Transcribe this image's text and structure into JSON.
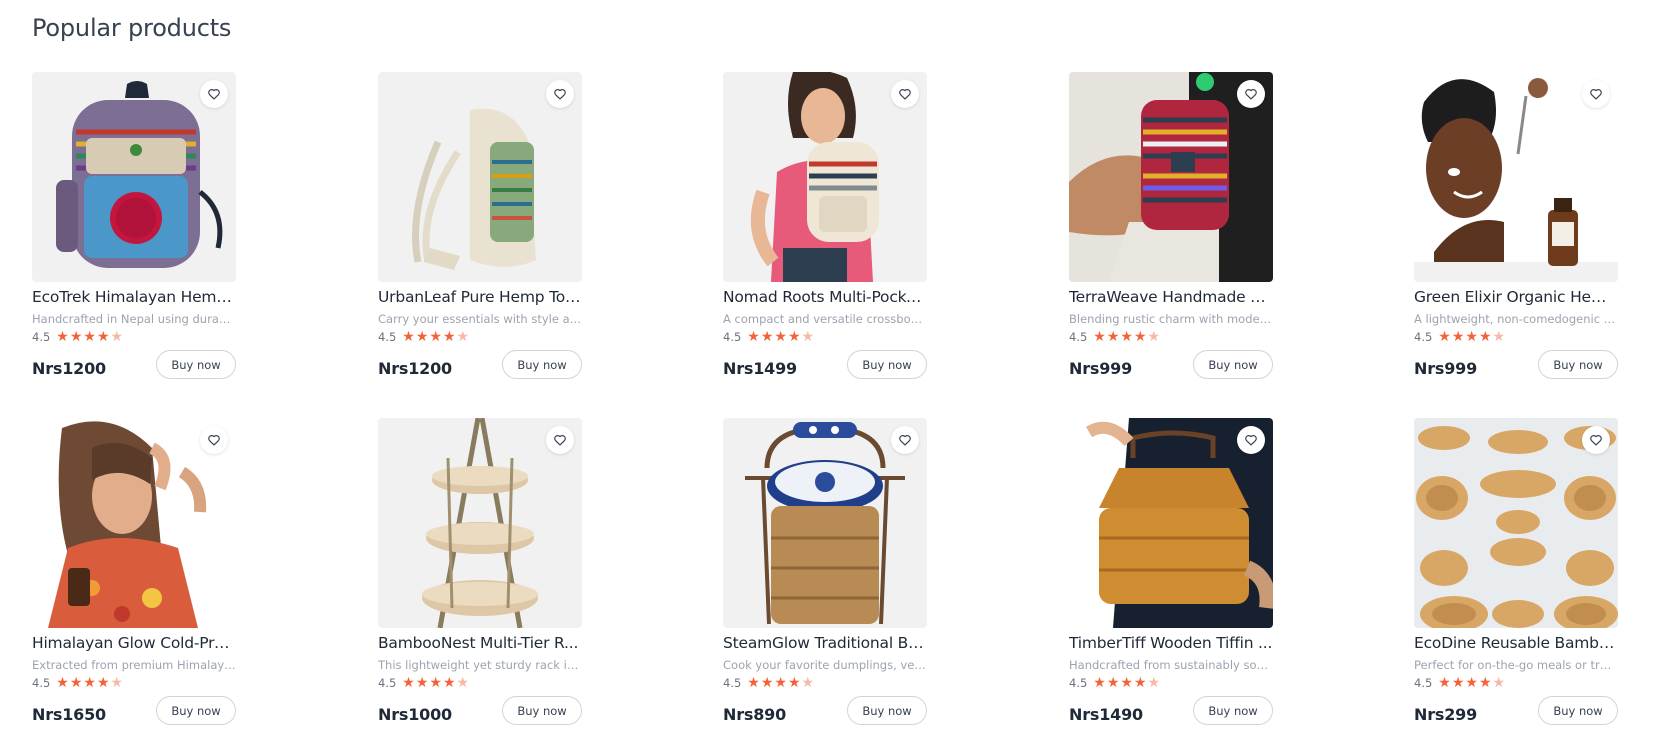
{
  "section": {
    "title": "Popular products"
  },
  "colors": {
    "star_on": "#f4623a",
    "star_off": "#f7b9a7",
    "thumb_bg": "#f1f1f2"
  },
  "products": [
    {
      "name": "EcoTrek Himalayan Hemp ...",
      "desc": "Handcrafted in Nepal using durable ...",
      "rating": "4.5",
      "stars_filled": 4,
      "price": "Nrs1200",
      "button": "Buy now",
      "image_icon": "hemp-backpack-icon"
    },
    {
      "name": "UrbanLeaf Pure Hemp Tot...",
      "desc": "Carry your essentials with style and ...",
      "rating": "4.5",
      "stars_filled": 4,
      "price": "Nrs1200",
      "button": "Buy now",
      "image_icon": "hemp-tote-backpack-icon"
    },
    {
      "name": "Nomad Roots Multi-Pocke...",
      "desc": "A compact and versatile crossbody ...",
      "rating": "4.5",
      "stars_filled": 4,
      "price": "Nrs1499",
      "button": "Buy now",
      "image_icon": "woman-with-backpack-icon"
    },
    {
      "name": "TerraWeave Handmade H...",
      "desc": "Blending rustic charm with modern ...",
      "rating": "4.5",
      "stars_filled": 4,
      "price": "Nrs999",
      "button": "Buy now",
      "image_icon": "striped-backpack-icon"
    },
    {
      "name": "Green Elixir Organic Hem...",
      "desc": "A lightweight, non-comedogenic oil ...",
      "rating": "4.5",
      "stars_filled": 4,
      "price": "Nrs999",
      "button": "Buy now",
      "image_icon": "face-oil-model-icon"
    },
    {
      "name": "Himalayan Glow Cold-Pre...",
      "desc": "Extracted from premium Himalaya...",
      "rating": "4.5",
      "stars_filled": 4,
      "price": "Nrs1650",
      "button": "Buy now",
      "image_icon": "woman-with-oil-bottle-icon"
    },
    {
      "name": "BambooNest Multi-Tier R...",
      "desc": "This lightweight yet sturdy rack is pe...",
      "rating": "4.5",
      "stars_filled": 4,
      "price": "Nrs1000",
      "button": "Buy now",
      "image_icon": "tiered-bamboo-rack-icon"
    },
    {
      "name": "SteamGlow Traditional Ba...",
      "desc": "Cook your favorite dumplings, vege...",
      "rating": "4.5",
      "stars_filled": 4,
      "price": "Nrs890",
      "button": "Buy now",
      "image_icon": "bamboo-steamer-tiffin-icon"
    },
    {
      "name": "TimberTiff Wooden Tiffin ...",
      "desc": "Handcrafted from sustainably sourc...",
      "rating": "4.5",
      "stars_filled": 4,
      "price": "Nrs1490",
      "button": "Buy now",
      "image_icon": "wooden-tiffin-basket-icon"
    },
    {
      "name": "EcoDine Reusable Bambo...",
      "desc": "Perfect for on-the-go meals or trav...",
      "rating": "4.5",
      "stars_filled": 4,
      "price": "Nrs299",
      "button": "Buy now",
      "image_icon": "bamboo-dinnerware-icon"
    }
  ]
}
